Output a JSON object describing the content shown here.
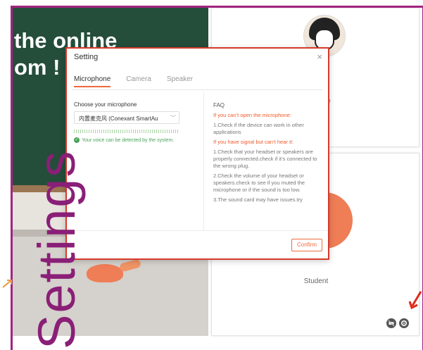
{
  "classroom": {
    "board_title_line1": "the online",
    "board_title_line2": "om !"
  },
  "teacher_tile": {
    "status_text": "ffline"
  },
  "student_tile": {
    "label": "Student",
    "icons": [
      "camera-off-icon",
      "gear-icon"
    ]
  },
  "dialog": {
    "title": "Setting",
    "close_glyph": "×",
    "tabs": [
      {
        "label": "Microphone",
        "active": true
      },
      {
        "label": "Camera",
        "active": false
      },
      {
        "label": "Speaker",
        "active": false
      }
    ],
    "choose_label": "Choose your microphone",
    "selected_mic": "内置麦克风 (Conexant SmartAu",
    "voice_status": "Your voice can be detected by the system.",
    "faq": {
      "title": "FAQ",
      "q1": "If you can’t open the microphone:",
      "a1": "1.Check if the device can work in other applications",
      "q2": "If you have signal but can’t hear it:",
      "a2_1": "1.Check that your headset or speakers are properly connected.check if it’s connected to the wrong plug.",
      "a2_2": "2.Check the volume of your headset or speakers.check to see if you muted the microphone or if the sound is too low.",
      "a2_3": "3.The sound card may have issues.try"
    },
    "confirm_label": "Confirm"
  },
  "annotation": {
    "settings_text": "Settings"
  },
  "colors": {
    "frame": "#a2247e",
    "accent": "#ef6a3a",
    "dialog_border": "#d63a2a",
    "success": "#4aa35a",
    "board": "#244d3a"
  }
}
